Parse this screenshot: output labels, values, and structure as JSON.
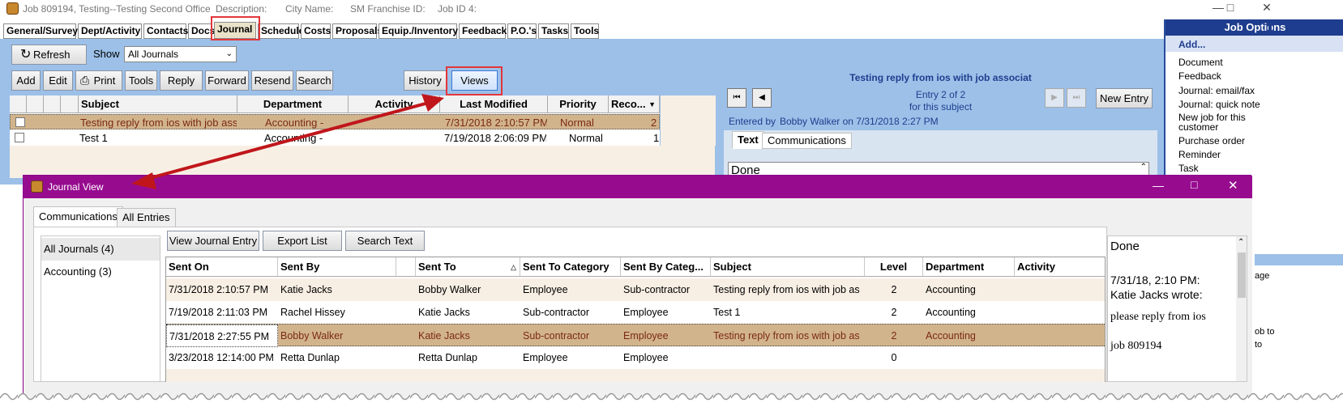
{
  "window": {
    "title_parts": [
      "Job 809194, Testing--Testing Second Office",
      "Description:",
      "City Name:",
      "SM Franchise ID:",
      "Job ID 4:"
    ]
  },
  "tabs": [
    "General/Survey",
    "Dept/Activity",
    "Contacts",
    "Docs",
    "Journal",
    "Schedule",
    "Costs",
    "Proposals",
    "Equip./Inventory",
    "Feedback",
    "P.O.'s",
    "Tasks",
    "Tools"
  ],
  "toolbar": {
    "refresh": "Refresh",
    "show_label": "Show",
    "show_value": "All Journals",
    "actions": [
      "Add",
      "Edit",
      "Print",
      "Tools",
      "Reply",
      "Forward",
      "Resend",
      "Search"
    ],
    "history": "History",
    "views": "Views"
  },
  "journal_grid": {
    "headers": [
      "Subject",
      "Department",
      "Activity",
      "Last Modified",
      "Priority",
      "Reco..."
    ],
    "rows": [
      {
        "subject": "Testing reply from ios with job ass",
        "department": "Accounting -",
        "activity": "",
        "modified": "7/31/2018 2:10:57 PM",
        "priority": "Normal",
        "records": "2"
      },
      {
        "subject": "Test 1",
        "department": "Accounting -",
        "activity": "",
        "modified": "7/19/2018 2:06:09 PM",
        "priority": "Normal",
        "records": "1"
      }
    ]
  },
  "entry_panel": {
    "subject": "Testing reply from ios with job associat",
    "entry_line1": "Entry 2 of 2",
    "entry_line2": "for this subject",
    "new_entry": "New Entry",
    "entered_by_label": "Entered by",
    "entered_by_value": "Bobby Walker on 7/31/2018 2:27 PM",
    "tab_text": "Text",
    "tab_comm": "Communications",
    "text_value": "Done"
  },
  "job_options": {
    "title": "Job Options",
    "add": "Add...",
    "items": [
      "Document",
      "Feedback",
      "Journal: email/fax",
      "Journal: quick note",
      "New job for this customer",
      "Purchase order",
      "Reminder",
      "Task"
    ],
    "clipped_right": [
      "age",
      "ob to",
      "to"
    ]
  },
  "journal_view": {
    "title": "Journal View",
    "tabs": [
      "Communications",
      "All Entries"
    ],
    "filters": [
      "All Journals (4)",
      "Accounting (3)"
    ],
    "buttons": [
      "View Journal Entry",
      "Export List",
      "Search Text"
    ],
    "headers": [
      "Sent On",
      "Sent By",
      "Sent To",
      "Sent To Category",
      "Sent By Categ...",
      "Subject",
      "Level",
      "Department",
      "Activity"
    ],
    "rows": [
      {
        "sent_on": "7/31/2018 2:10:57 PM",
        "sent_by": "Katie Jacks",
        "sent_to": "Bobby Walker",
        "to_cat": "Employee",
        "by_cat": "Sub-contractor",
        "subject": "Testing reply from ios with job as",
        "level": "2",
        "department": "Accounting",
        "activity": ""
      },
      {
        "sent_on": "7/19/2018 2:11:03 PM",
        "sent_by": "Rachel Hissey",
        "sent_to": "Katie Jacks",
        "to_cat": "Sub-contractor",
        "by_cat": "Employee",
        "subject": "Test 1",
        "level": "2",
        "department": "Accounting",
        "activity": ""
      },
      {
        "sent_on": "7/31/2018 2:27:55 PM",
        "sent_by": "Bobby Walker",
        "sent_to": "Katie Jacks",
        "to_cat": "Sub-contractor",
        "by_cat": "Employee",
        "subject": "Testing reply from ios with job as",
        "level": "2",
        "department": "Accounting",
        "activity": ""
      },
      {
        "sent_on": "3/23/2018 12:14:00 PM",
        "sent_by": "Retta Dunlap",
        "sent_to": "Retta Dunlap",
        "to_cat": "Employee",
        "by_cat": "Employee",
        "subject": "",
        "level": "0",
        "department": "",
        "activity": ""
      }
    ],
    "note": {
      "line1": "Done",
      "line2": "7/31/18, 2:10 PM:",
      "line3": "Katie Jacks wrote:",
      "line4": "please reply from ios",
      "line5": "job 809194"
    }
  },
  "colors": {
    "app_bg": "#9cc0e8",
    "selected_row": "#d2b48c",
    "jv_title": "#970c8f",
    "highlight": "#e3363a",
    "arrow": "#c0161b"
  }
}
